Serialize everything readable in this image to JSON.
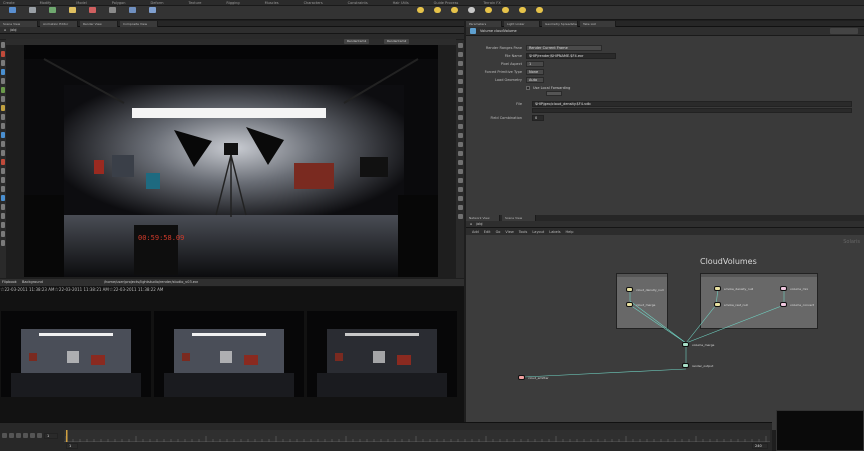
{
  "shelf": {
    "tabs": [
      "Create",
      "Modify",
      "Model",
      "Polygon",
      "Deform",
      "Texture",
      "Rigging",
      "Muscles",
      "Characters",
      "Constraints",
      "Hair Utils",
      "Guide Process",
      "Terrain FX"
    ],
    "tools": [
      {
        "icon": "object-icon",
        "color": "#5a8fd0"
      },
      {
        "icon": "camera-icon",
        "color": "#9aa0a6"
      },
      {
        "icon": "grid-icon",
        "color": "#6fa86f"
      },
      {
        "icon": "light-icon",
        "color": "#e0c060"
      },
      {
        "icon": "spot-icon",
        "color": "#d06060"
      },
      {
        "icon": "null-icon",
        "color": "#8a8a8a"
      },
      {
        "icon": "box-icon",
        "color": "#7090c0"
      },
      {
        "icon": "sphere-icon",
        "color": "#80a0d0"
      }
    ],
    "right_tools": [
      {
        "icon": "point-light-icon",
        "color": "#e6c34a"
      },
      {
        "icon": "spot-light-icon",
        "color": "#e6c34a"
      },
      {
        "icon": "area-light-icon",
        "color": "#e6c34a"
      },
      {
        "icon": "geo-light-icon",
        "color": "#c8c8c8"
      },
      {
        "icon": "volume-light-icon",
        "color": "#e6c34a"
      },
      {
        "icon": "distant-light-icon",
        "color": "#e6c34a"
      },
      {
        "icon": "env-light-icon",
        "color": "#e6c34a"
      },
      {
        "icon": "sky-light-icon",
        "color": "#e6c34a"
      }
    ]
  },
  "left_pane": {
    "tabs": [
      "Scene View",
      "Animation Editor",
      "Render View",
      "Composite View"
    ],
    "path": "/obj",
    "viewport": {
      "cameras": [
        "RenderCam1",
        "RenderCam2"
      ],
      "clock_text": "00:59:58.09"
    }
  },
  "composite": {
    "tabs": [
      "Flipbook",
      "Background"
    ],
    "path_text": "/home/user/projects/lightstudio/render/studio_v03.exr",
    "snapshots": [
      {
        "label": "22-03-2011 11:38:23 AM"
      },
      {
        "label": "22-03-2011 11:38:21 AM"
      },
      {
        "label": "22-03-2011 11:38:22 AM"
      }
    ]
  },
  "params": {
    "tabs": [
      "Parameters",
      "Light Linker",
      "Geometry Spreadsheet",
      "Take List"
    ],
    "node_title": "Volume  cloudVolume",
    "rows": [
      {
        "label": "Render Ranges Pane",
        "value": "Render Current Frame"
      },
      {
        "label": "File Name",
        "value": "$HIP/render/$HIPNAME.$F4.exr"
      },
      {
        "label": "Pixel Aspect",
        "value": "1"
      },
      {
        "label": "Forced Primitive Type",
        "value": "None"
      },
      {
        "label": "Load Geometry",
        "value": "Auto"
      },
      {
        "label": "",
        "value": "Use Local Forwarding"
      },
      {
        "label": "File",
        "value": "$HIP/geo/cloud_density.$F4.vdb"
      },
      {
        "label": "Field Combination",
        "value": "0"
      }
    ]
  },
  "network": {
    "tabs": [
      "Network View",
      "Scene View"
    ],
    "menu": [
      "Add",
      "Edit",
      "Go",
      "View",
      "Tools",
      "Layout",
      "Labels",
      "Help"
    ],
    "path": "/obj",
    "watermark": "Solaris",
    "title": "CloudVolumes",
    "nodes": [
      {
        "name": "cloud_density_null"
      },
      {
        "name": "cloud_merge"
      },
      {
        "name": "smoke_density_null"
      },
      {
        "name": "smoke_rest_null"
      },
      {
        "name": "volume_mix"
      },
      {
        "name": "volume_convert"
      },
      {
        "name": "volume_merge"
      },
      {
        "name": "render_output"
      },
      {
        "name": "cloud_emitter"
      }
    ]
  },
  "timeline": {
    "frame": "1",
    "start": "1",
    "end": "240"
  }
}
